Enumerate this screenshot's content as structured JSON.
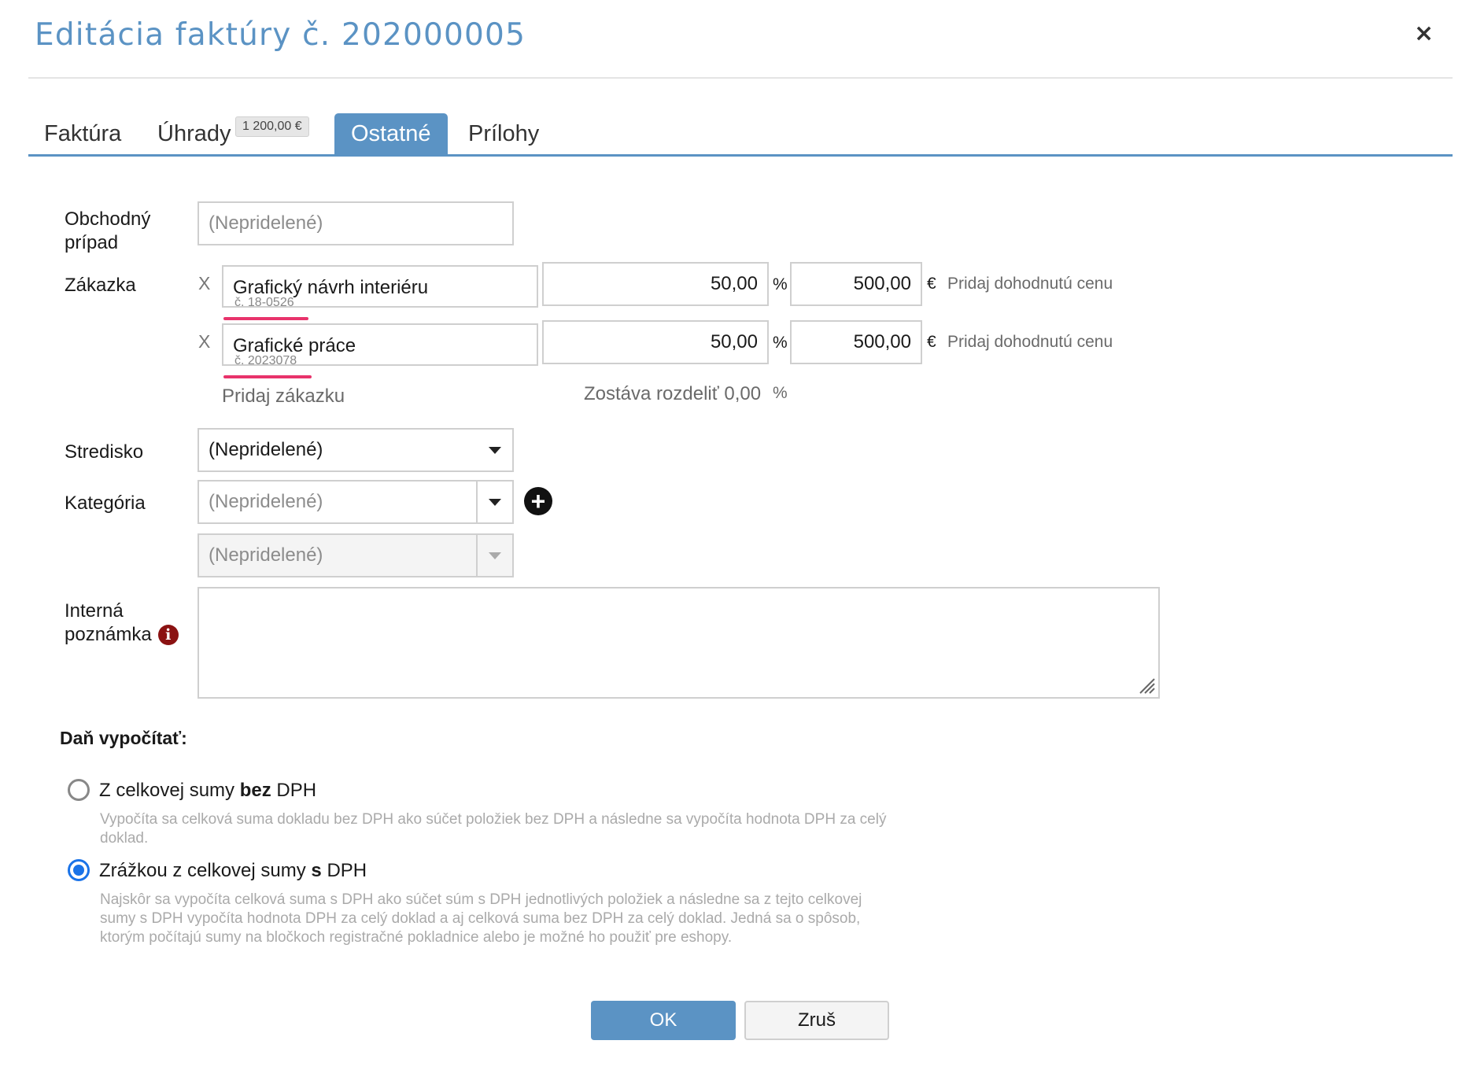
{
  "dialog": {
    "title": "Editácia faktúry č. 202000005",
    "close": "×"
  },
  "tabs": [
    {
      "label": "Faktúra",
      "active": false
    },
    {
      "label": "Úhrady",
      "badge": "1 200,00 €",
      "active": false
    },
    {
      "label": "Ostatné",
      "active": true
    },
    {
      "label": "Prílohy",
      "active": false
    }
  ],
  "form": {
    "business_case": {
      "label_line1": "Obchodný",
      "label_line2": "prípad",
      "placeholder": "(Nepridelené)"
    },
    "orders": {
      "label": "Zákazka",
      "remove": "X",
      "items": [
        {
          "name": "Grafický návrh interiéru",
          "number": "č. 18-0526",
          "percent": "50,00",
          "amount": "500,00"
        },
        {
          "name": "Grafické práce",
          "number": "č. 2023078",
          "percent": "50,00",
          "amount": "500,00"
        }
      ],
      "percent_unit": "%",
      "currency_unit": "€",
      "add_price_link": "Pridaj dohodnutú cenu",
      "add_order_link": "Pridaj zákazku",
      "remaining_text": "Zostáva rozdeliť 0,00",
      "remaining_unit": "%"
    },
    "center": {
      "label": "Stredisko",
      "value": "(Nepridelené)"
    },
    "category": {
      "label": "Kategória",
      "placeholder": "(Nepridelené)",
      "sub_placeholder": "(Nepridelené)"
    },
    "internal_note": {
      "label_line1": "Interná",
      "label_line2": "poznámka",
      "value": ""
    }
  },
  "tax": {
    "title": "Daň vypočítať:",
    "options": [
      {
        "text_before": "Z celkovej sumy ",
        "text_bold": "bez",
        "text_after": " DPH",
        "description": "Vypočíta sa celková suma dokladu bez DPH ako súčet položiek bez DPH a následne sa vypočíta hodnota DPH za celý doklad.",
        "selected": false
      },
      {
        "text_before": "Zrážkou z celkovej sumy ",
        "text_bold": "s",
        "text_after": " DPH",
        "description": "Najskôr sa vypočíta celková suma s DPH ako súčet súm s DPH jednotlivých položiek a následne sa z tejto celkovej sumy s DPH vypočíta hodnota DPH za celý doklad a aj celková suma bez DPH za celý doklad. Jedná sa o spôsob, ktorým počítajú sumy na bločkoch registračné pokladnice alebo je možné ho použiť pre eshopy.",
        "selected": true
      }
    ]
  },
  "buttons": {
    "ok": "OK",
    "cancel": "Zruš"
  }
}
